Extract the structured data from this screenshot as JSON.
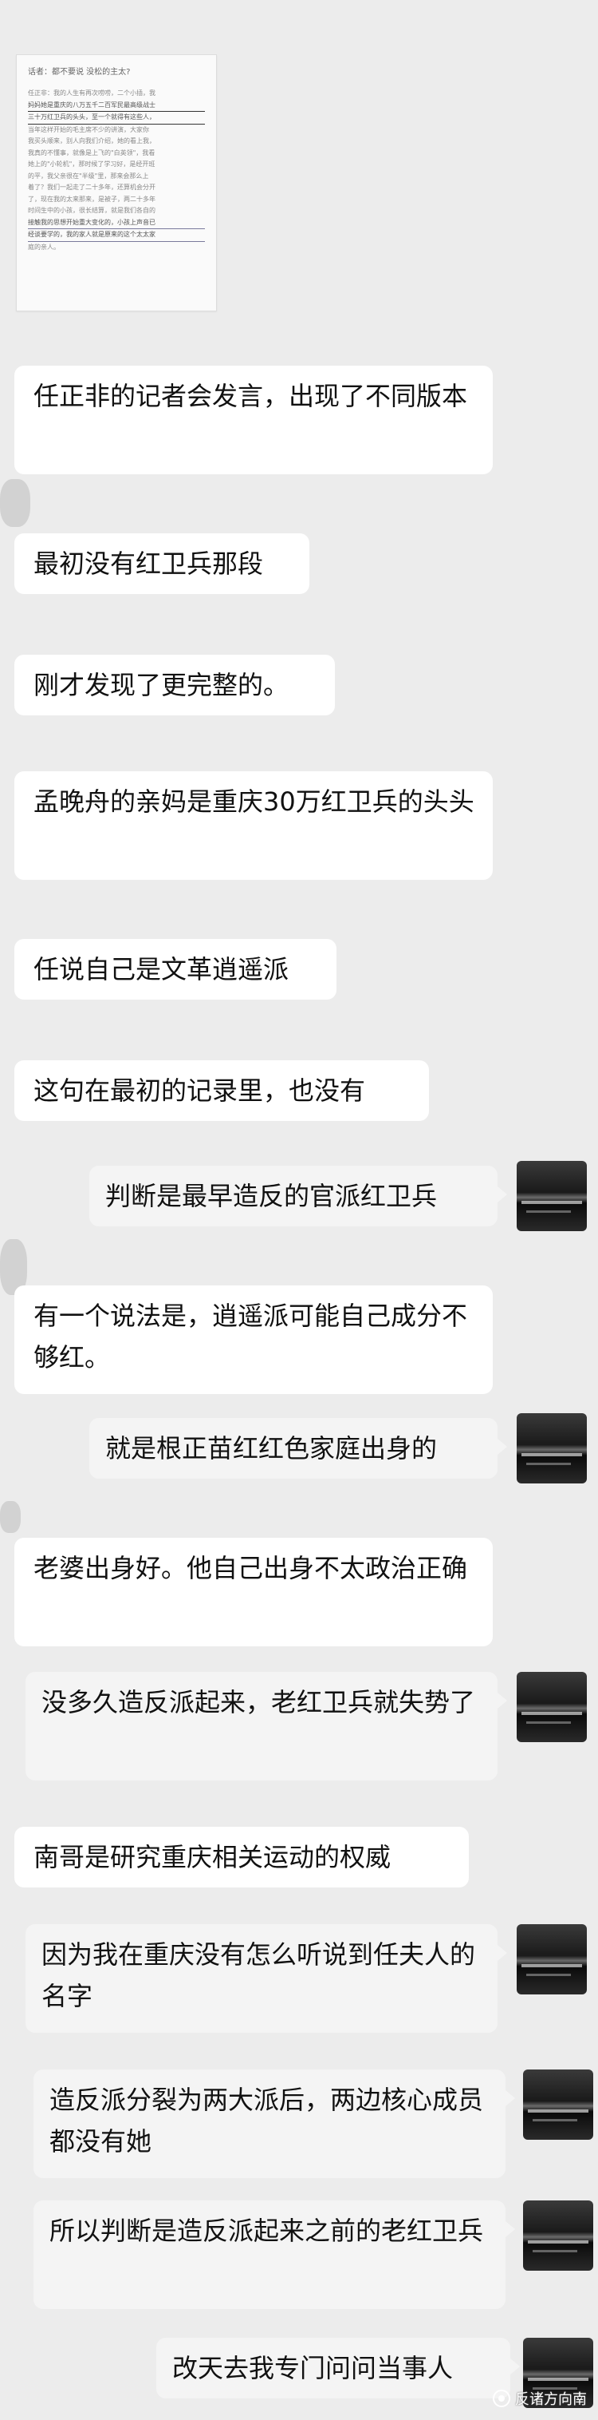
{
  "doc": {
    "title": "话者：都不要说  没松的主太?",
    "body_lines": [
      "任正非：我的人生有再次唠唠，二个小插，我",
      "妈妈她是重庆的八万五千二百军民最高级战士",
      "三十万红卫兵的头头，至一个就得有这些人，",
      "当年这样开始的毛主席不少的讲演，大家你",
      "我买头顺来，别人向我们介绍，她的看上我，",
      "我真的不懂事，就像是上飞的\"白英领\"，我看",
      "她上的\"小轮机\"，那时候了学习好，是经开班",
      "的平，我父亲很在\"半级\"里，那来会那么上",
      "着了？我们一起走了二十多年，还算机会分开",
      "了，现在我的太来那来，是被子，两二十多年",
      "时间生中的小孩，很长结算，就是我们各自的",
      "接触我的思想开始重大变化的，小孩上声音已",
      "经谈要学的，我的家人就是原来的这个太太家",
      "庭的亲人。"
    ]
  },
  "messages": [
    {
      "side": "left",
      "text": "任正非的记者会发言，出现了不同版本"
    },
    {
      "side": "left",
      "text": "最初没有红卫兵那段"
    },
    {
      "side": "left",
      "text": "刚才发现了更完整的。"
    },
    {
      "side": "left",
      "text": "孟晚舟的亲妈是重庆30万红卫兵的头头"
    },
    {
      "side": "left",
      "text": "任说自己是文革逍遥派"
    },
    {
      "side": "left",
      "text": "这句在最初的记录里，也没有"
    },
    {
      "side": "right",
      "text": "判断是最早造反的官派红卫兵"
    },
    {
      "side": "left",
      "text": "有一个说法是，逍遥派可能自己成分不够红。"
    },
    {
      "side": "right",
      "text": "就是根正苗红红色家庭出身的"
    },
    {
      "side": "left",
      "text": "老婆出身好。他自己出身不太政治正确"
    },
    {
      "side": "right",
      "text": "没多久造反派起来，老红卫兵就失势了"
    },
    {
      "side": "left",
      "text": "南哥是研究重庆相关运动的权威"
    },
    {
      "side": "right",
      "text": "因为我在重庆没有怎么听说到任夫人的名字"
    },
    {
      "side": "right",
      "text": "造反派分裂为两大派后，两边核心成员都没有她"
    },
    {
      "side": "right",
      "text": "所以判断是造反派起来之前的老红卫兵"
    },
    {
      "side": "right",
      "text": "改天去我专门问问当事人"
    }
  ],
  "watermark": "反诸方向南"
}
